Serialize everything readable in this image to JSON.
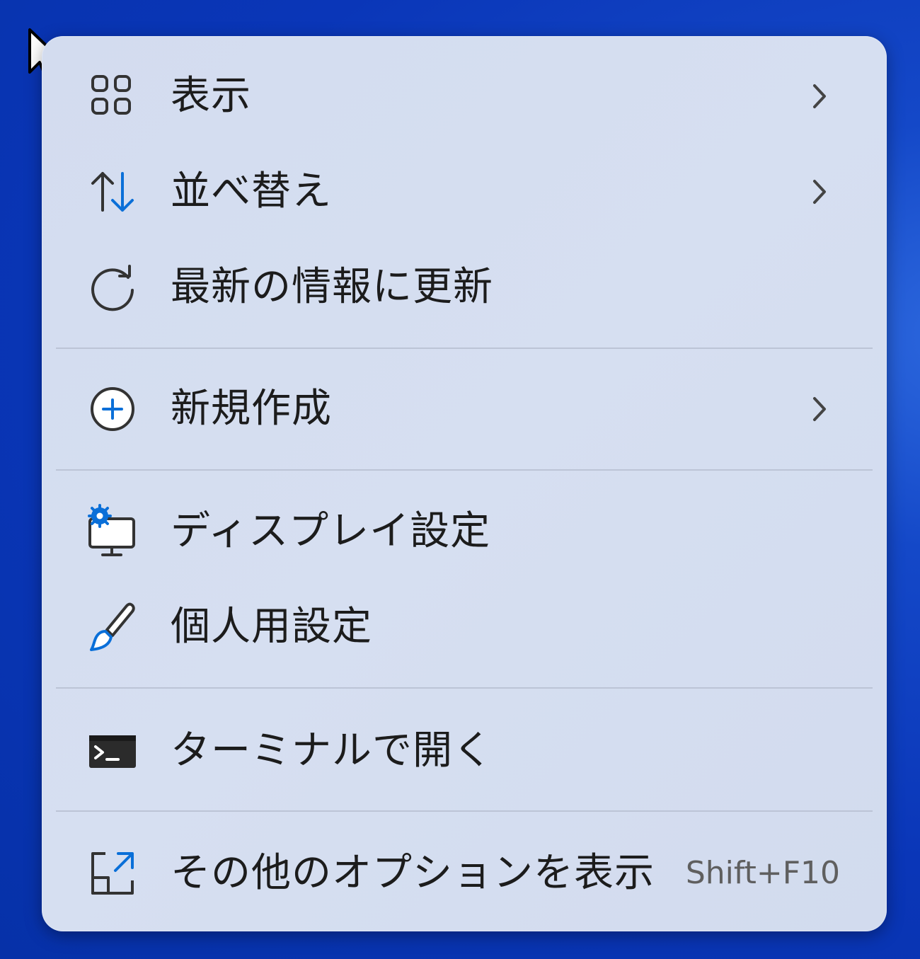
{
  "colors": {
    "accent": "#0a6fd8",
    "text": "#1c1c1c",
    "shortcut_text": "#5f5f5f",
    "menu_background": "#d5def0",
    "desktop_background": "#0a36b8"
  },
  "menu": {
    "items": [
      {
        "label": "表示",
        "icon": "view-grid-icon",
        "has_submenu": true
      },
      {
        "label": "並べ替え",
        "icon": "sort-arrows-icon",
        "has_submenu": true
      },
      {
        "label": "最新の情報に更新",
        "icon": "refresh-icon",
        "has_submenu": false
      },
      {
        "label": "新規作成",
        "icon": "new-plus-circle-icon",
        "has_submenu": true
      },
      {
        "label": "ディスプレイ設定",
        "icon": "display-settings-icon",
        "has_submenu": false
      },
      {
        "label": "個人用設定",
        "icon": "paintbrush-icon",
        "has_submenu": false
      },
      {
        "label": "ターミナルで開く",
        "icon": "terminal-icon",
        "has_submenu": false
      },
      {
        "label": "その他のオプションを表示",
        "icon": "more-options-icon",
        "has_submenu": false,
        "shortcut": "Shift+F10"
      }
    ]
  }
}
